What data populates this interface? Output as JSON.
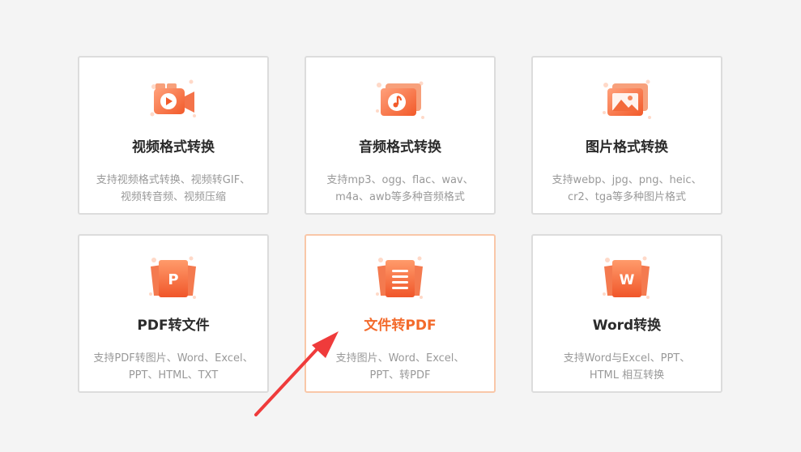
{
  "accent_color": "#f36a2b",
  "cards": [
    {
      "icon": "video-camera-icon",
      "title": "视频格式转换",
      "desc_lines": [
        "支持视频格式转换、视频转GIF、",
        "视频转音频、视频压缩"
      ]
    },
    {
      "icon": "music-note-icon",
      "title": "音频格式转换",
      "desc_lines": [
        "支持mp3、ogg、flac、wav、",
        "m4a、awb等多种音频格式"
      ]
    },
    {
      "icon": "image-icon",
      "title": "图片格式转换",
      "desc_lines": [
        "支持webp、jpg、png、heic、",
        "cr2、tga等多种图片格式"
      ]
    },
    {
      "icon": "pdf-file-icon",
      "title": "PDF转文件",
      "desc_lines": [
        "支持PDF转图片、Word、Excel、",
        "PPT、HTML、TXT"
      ]
    },
    {
      "icon": "document-lines-icon",
      "title": "文件转PDF",
      "desc_lines": [
        "支持图片、Word、Excel、",
        "PPT、转PDF"
      ]
    },
    {
      "icon": "word-file-icon",
      "title": "Word转换",
      "desc_lines": [
        "支持Word与Excel、PPT、",
        "HTML 相互转换"
      ]
    }
  ],
  "pdf_letter": "P",
  "word_letter": "W"
}
